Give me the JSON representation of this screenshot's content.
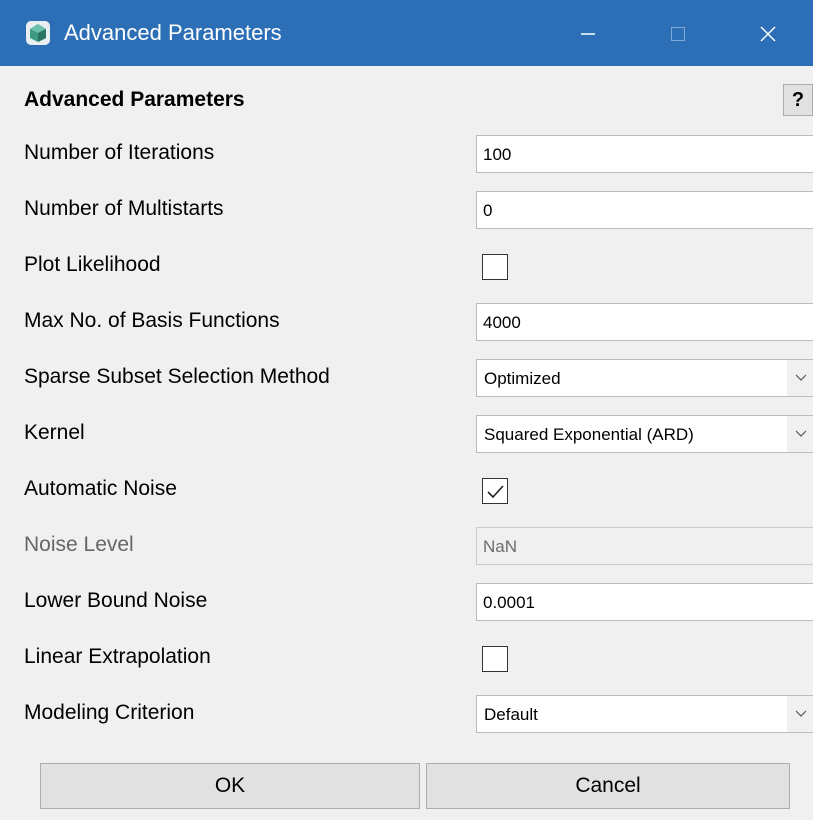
{
  "window": {
    "title": "Advanced Parameters",
    "title_bar_color": "#2c6fb6",
    "controls": {
      "minimize_icon": "minimize-icon",
      "maximize_icon": "maximize-icon",
      "close_icon": "close-icon"
    }
  },
  "header": {
    "title": "Advanced Parameters",
    "help_label": "?"
  },
  "params": {
    "iterations": {
      "label": "Number of Iterations",
      "value": "100"
    },
    "multistarts": {
      "label": "Number of Multistarts",
      "value": "0"
    },
    "plot_likelihood": {
      "label": "Plot Likelihood",
      "checked": false
    },
    "max_basis": {
      "label": "Max No. of Basis Functions",
      "value": "4000"
    },
    "sparse_method": {
      "label": "Sparse Subset Selection Method",
      "selected": "Optimized"
    },
    "kernel": {
      "label": "Kernel",
      "selected": "Squared Exponential (ARD)"
    },
    "auto_noise": {
      "label": "Automatic Noise",
      "checked": true
    },
    "noise_level": {
      "label": "Noise Level",
      "value": "NaN",
      "disabled": true
    },
    "lower_bound_noise": {
      "label": "Lower Bound Noise",
      "value": "0.0001"
    },
    "linear_extrapolation": {
      "label": "Linear Extrapolation",
      "checked": false
    },
    "modeling_criterion": {
      "label": "Modeling Criterion",
      "selected": "Default"
    }
  },
  "buttons": {
    "ok": "OK",
    "cancel": "Cancel"
  }
}
